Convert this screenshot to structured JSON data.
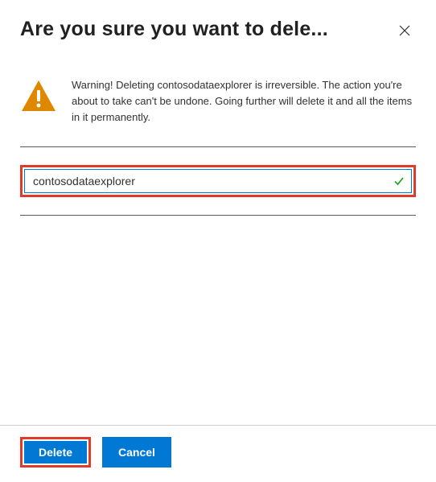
{
  "header": {
    "title": "Are you sure you want to dele..."
  },
  "warning": {
    "text": "Warning! Deleting contosodataexplorer is irreversible. The action you're about to take can't be undone. Going further will delete it and all the items in it permanently."
  },
  "input": {
    "value": "contosodataexplorer"
  },
  "footer": {
    "delete_label": "Delete",
    "cancel_label": "Cancel"
  },
  "icons": {
    "warning_name": "warning-triangle-icon",
    "check_name": "checkmark-icon",
    "close_name": "close-icon"
  },
  "colors": {
    "primary": "#0078d4",
    "highlight_border": "#e03a2a",
    "warning_orange": "#e08700",
    "success_green": "#15a315"
  }
}
